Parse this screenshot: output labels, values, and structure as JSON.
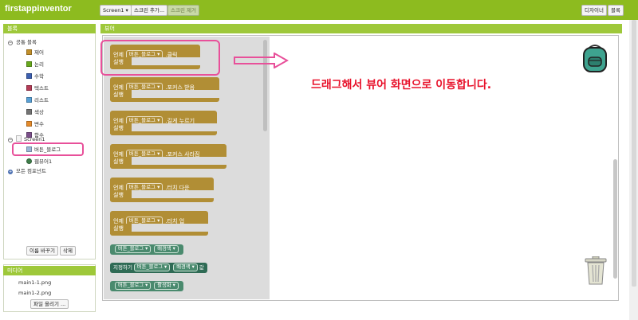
{
  "app": {
    "title": "firstappinventor"
  },
  "toolbar": {
    "screen_select": "Screen1 ▾",
    "add_screen": "스크린 추가...",
    "remove_screen": "스크린 제거",
    "designer": "디자이너",
    "blocks": "블록"
  },
  "blocks_panel": {
    "header": "블록",
    "builtin": "공통 블록",
    "items": [
      {
        "label": "제어",
        "color": "#c28f2a"
      },
      {
        "label": "논리",
        "color": "#67a81c"
      },
      {
        "label": "수학",
        "color": "#3d60b1"
      },
      {
        "label": "텍스트",
        "color": "#b43b56"
      },
      {
        "label": "리스트",
        "color": "#58a0d6"
      },
      {
        "label": "색상",
        "color": "#737373"
      },
      {
        "label": "변수",
        "color": "#e58b2b"
      },
      {
        "label": "함수",
        "color": "#7b4f8a"
      }
    ],
    "screen": "Screen1",
    "button_block": "버튼_블로그",
    "webviewer": "웹뷰어1",
    "any_component": "모든 컴포넌트",
    "rename": "이름 바꾸기",
    "delete": "삭제"
  },
  "media_panel": {
    "header": "미디어",
    "files": [
      "main1-1.png",
      "main1-2.png"
    ],
    "upload": "파일 올리기 ..."
  },
  "viewer": {
    "header": "뷰어",
    "events": [
      {
        "when": "언제",
        "component": "버튼_블로그 ▾",
        "event": ".클릭",
        "do": "실행"
      },
      {
        "when": "언제",
        "component": "버튼_블로그 ▾",
        "event": ".포커스 받음",
        "do": "실행"
      },
      {
        "when": "언제",
        "component": "버튼_블로그 ▾",
        "event": ".길게 누르기",
        "do": "실행"
      },
      {
        "when": "언제",
        "component": "버튼_블로그 ▾",
        "event": ".포커스 사라짐",
        "do": "실행"
      },
      {
        "when": "언제",
        "component": "버튼_블로그 ▾",
        "event": ".터치 다운",
        "do": "실행"
      },
      {
        "when": "언제",
        "component": "버튼_블로그 ▾",
        "event": ".터치 업",
        "do": "실행"
      }
    ],
    "getter_bg": {
      "component": "버튼_블로그 ▾",
      "prop": "배경색 ▾"
    },
    "setter": {
      "set": "지정하기",
      "component": "버튼_블로그 ▾",
      "prop": "배경색 ▾",
      "to": "값"
    },
    "getter_enabled": {
      "component": "버튼_블로그 ▾",
      "prop": "활성화 ▾"
    },
    "annotation": "드래그해서 뷰어 화면으로 이동합니다."
  },
  "colors": {
    "topbar": "#8dbb1f",
    "event_block": "#b18e35",
    "component_block": "#4a8a6e",
    "highlight": "#e8509a",
    "annotation_text": "#e8122b"
  }
}
